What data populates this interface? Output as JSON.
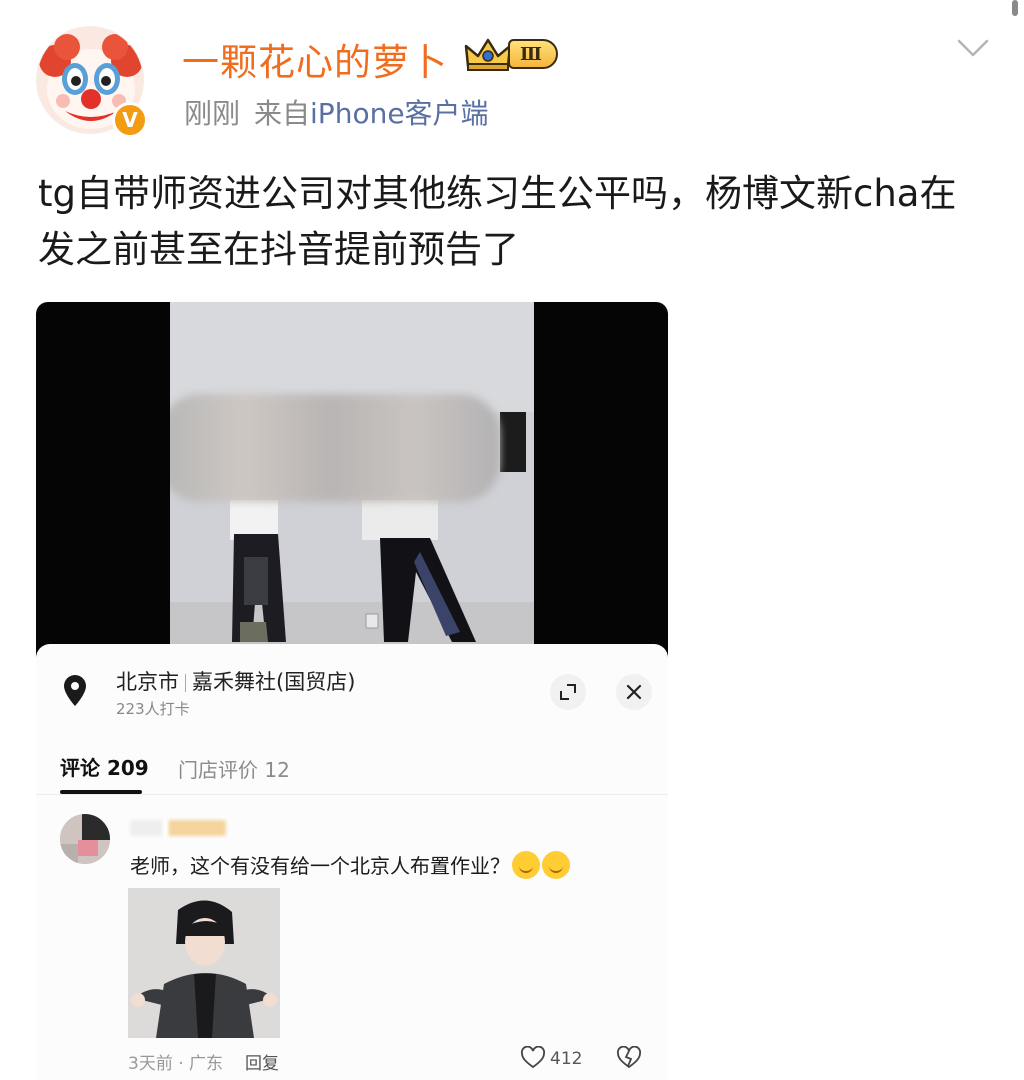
{
  "post": {
    "username": "一颗花心的萝卜",
    "rank_badge": "Ⅲ",
    "time": "刚刚",
    "source_prefix": "来自",
    "source_client": "iPhone客户端",
    "text": "tg自带师资进公司对其他练习生公平吗，杨博文新cha在发之前甚至在抖音提前预告了"
  },
  "icons": {
    "avatar": "clown-face-avatar",
    "verified": "verified-v-badge",
    "rank": "crown-icon",
    "more": "chevron-down-icon",
    "location": "map-pin-icon",
    "expand": "expand-icon",
    "close": "close-icon",
    "like": "heart-icon",
    "dislike": "broken-heart-icon"
  },
  "colors": {
    "username": "#f26c1e",
    "client_link": "#5a6fa3",
    "verified_badge": "#f39c12"
  },
  "screenshot": {
    "location": {
      "city": "北京市",
      "place": "嘉禾舞社(国贸店)",
      "checkins": "223人打卡"
    },
    "tabs": [
      {
        "label": "评论 209",
        "active": true
      },
      {
        "label": "门店评价 12",
        "active": false
      }
    ],
    "comment": {
      "text": "老师，这个有没有给一个北京人布置作业？",
      "time_region": "3天前 · 广东",
      "reply_label": "回复",
      "like_count": "412"
    }
  }
}
